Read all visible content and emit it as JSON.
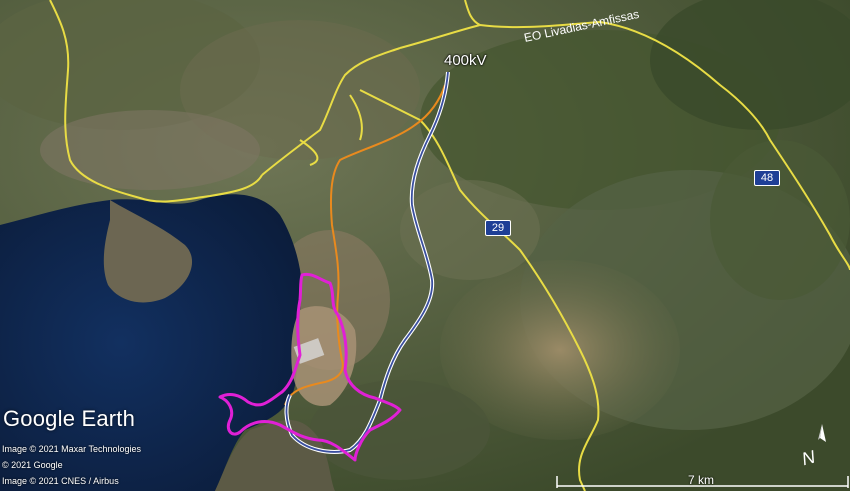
{
  "labels": {
    "road_name": "EO Livadias-Amfissas",
    "line_400kv": "400kV",
    "shield_29": "29",
    "shield_48": "48"
  },
  "branding": {
    "logo": "Google Earth"
  },
  "credits": [
    "Image © 2021 Maxar Technologies",
    "© 2021 Google",
    "Image © 2021 CNES / Airbus"
  ],
  "scale": {
    "label": "7 km"
  },
  "colors": {
    "road": "#e8dc45",
    "orange_route": "#e98a1e",
    "blue_route": "#3a4f9f",
    "site_boundary": "#e020d6",
    "sea": "#0f2547"
  },
  "icons": {
    "compass": "north-arrow-icon"
  }
}
